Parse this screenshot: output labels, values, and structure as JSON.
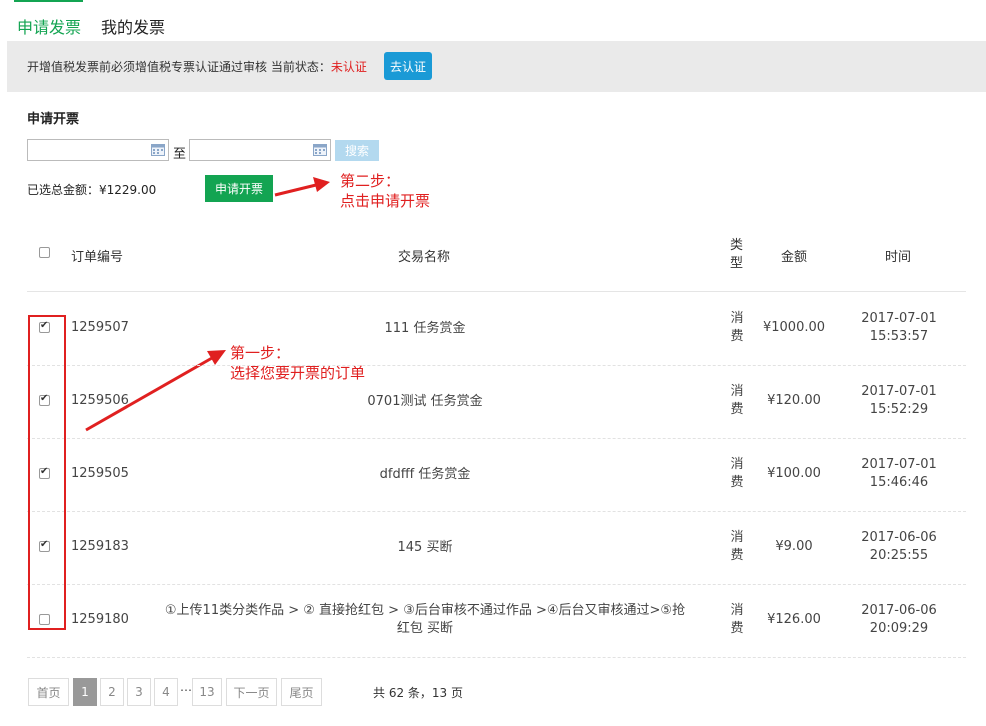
{
  "tabs": [
    {
      "label": "申请发票",
      "active": true
    },
    {
      "label": "我的发票",
      "active": false
    }
  ],
  "notice": {
    "text": "开增值税发票前必须增值税专票认证通过审核 当前状态：",
    "status": "未认证",
    "button_label": "去认证"
  },
  "section_title": "申请开票",
  "search": {
    "start_date": "",
    "end_date": "",
    "to_label": "至",
    "button_label": "搜索"
  },
  "selected_total": "已选总金额：¥1229.00",
  "apply_button_label": "申请开票",
  "annotations": {
    "step2_line1": "第二步：",
    "step2_line2": "点击申请开票",
    "step1_line1": "第一步：",
    "step1_line2": "选择您要开票的订单"
  },
  "table": {
    "headers": {
      "order_no": "订单编号",
      "name": "交易名称",
      "type_line1": "类",
      "type_line2": "型",
      "amount": "金额",
      "time": "时间"
    },
    "rows": [
      {
        "checked": true,
        "order_no": "1259507",
        "name_line1": "111 任务赏金",
        "name_line2": "",
        "type_line1": "消",
        "type_line2": "费",
        "amount": "¥1000.00",
        "date": "2017-07-01",
        "time": "15:53:57"
      },
      {
        "checked": true,
        "order_no": "1259506",
        "name_line1": "0701测试 任务赏金",
        "name_line2": "",
        "type_line1": "消",
        "type_line2": "费",
        "amount": "¥120.00",
        "date": "2017-07-01",
        "time": "15:52:29"
      },
      {
        "checked": true,
        "order_no": "1259505",
        "name_line1": "dfdfff 任务赏金",
        "name_line2": "",
        "type_line1": "消",
        "type_line2": "费",
        "amount": "¥100.00",
        "date": "2017-07-01",
        "time": "15:46:46"
      },
      {
        "checked": true,
        "order_no": "1259183",
        "name_line1": "145 买断",
        "name_line2": "",
        "type_line1": "消",
        "type_line2": "费",
        "amount": "¥9.00",
        "date": "2017-06-06",
        "time": "20:25:55"
      },
      {
        "checked": false,
        "order_no": "1259180",
        "name_line1": "①上传11类分类作品 > ② 直接抢红包 > ③后台审核不通过作品 >④后台又审核通过>⑤抢",
        "name_line2": "红包 买断",
        "type_line1": "消",
        "type_line2": "费",
        "amount": "¥126.00",
        "date": "2017-06-06",
        "time": "20:09:29"
      }
    ]
  },
  "pagination": {
    "first": "首页",
    "pages": [
      "1",
      "2",
      "3",
      "4"
    ],
    "ellipsis": "…",
    "last_page": "13",
    "next": "下一页",
    "last": "尾页",
    "summary": "共 62 条，13 页"
  },
  "colors": {
    "accent_green": "#13a452",
    "accent_blue": "#1a9ad6",
    "alert_red": "#e02020"
  }
}
